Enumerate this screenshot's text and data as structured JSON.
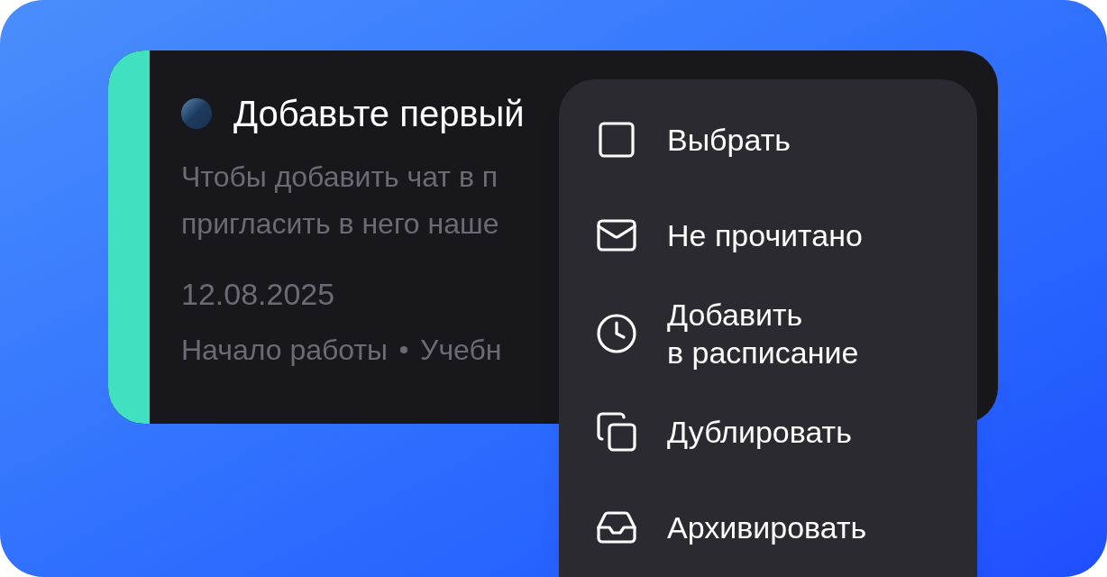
{
  "card": {
    "title": "Добавьте первый",
    "preview_lines": [
      "Чтобы добавить чат в п",
      "пригласить в него наше"
    ],
    "date": "12.08.2025",
    "tags": [
      "Начало работы",
      "Учебн"
    ]
  },
  "context_menu": {
    "items": [
      {
        "label": "Выбрать"
      },
      {
        "label": "Не прочитано"
      },
      {
        "label": "Добавить\nв расписание"
      },
      {
        "label": "Дублировать"
      },
      {
        "label": "Архивировать"
      }
    ]
  }
}
